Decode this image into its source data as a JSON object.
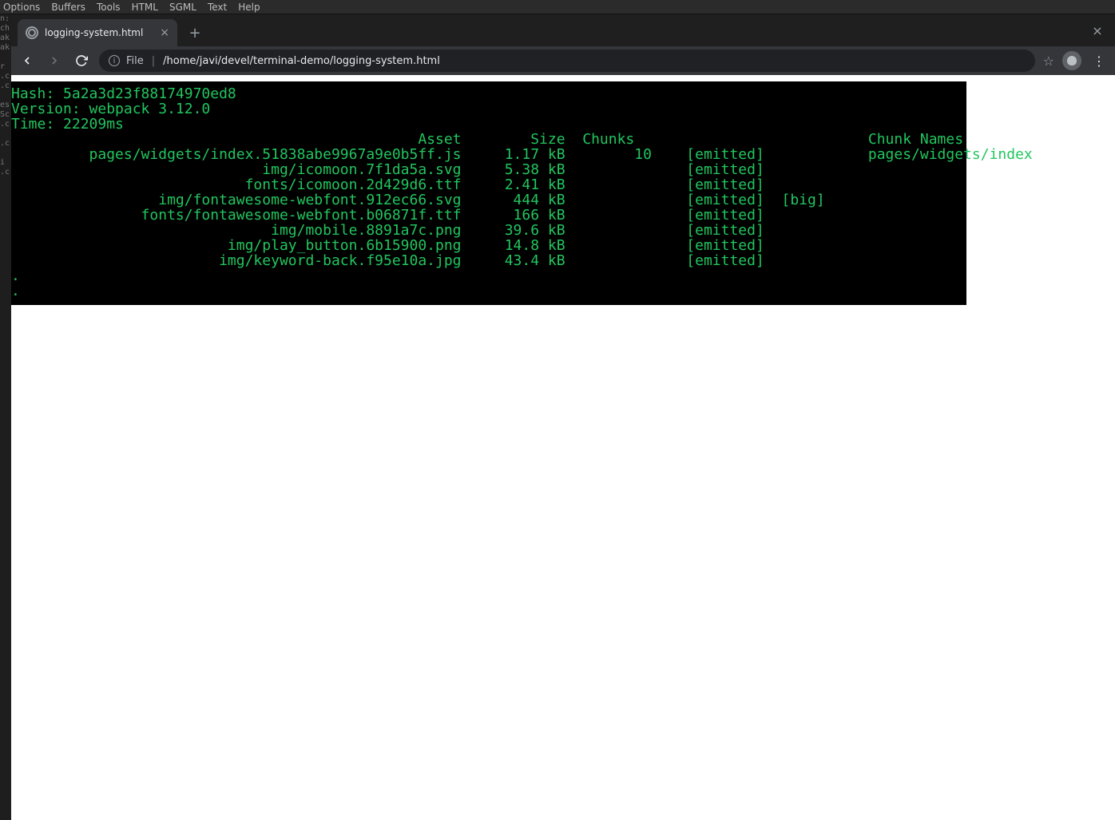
{
  "emacs_menu": [
    "Options",
    "Buffers",
    "Tools",
    "HTML",
    "SGML",
    "Text",
    "Help"
  ],
  "bg_editor_text": "n:\nch\nak\nak\n\nr\n.c\n.c\n\nes\nSc\n.c\n\n.c\n\ni\n.c",
  "browser": {
    "tab_title": "logging-system.html",
    "window_close": "×",
    "tab_close": "×",
    "newtab": "+",
    "nav": {
      "back": "←",
      "forward": "→",
      "reload": "⟳"
    },
    "omnibox": {
      "scheme": "File",
      "path": "/home/javi/devel/terminal-demo/logging-system.html"
    },
    "star": "☆",
    "kebab": "⋮"
  },
  "terminal": {
    "hash_label": "Hash:",
    "hash": "5a2a3d23f88174970ed8",
    "version_label": "Version:",
    "version": "webpack 3.12.0",
    "time_label": "Time:",
    "time": "22209ms",
    "columns": {
      "asset": "Asset",
      "size": "Size",
      "chunks": "Chunks",
      "chunk_names": "Chunk Names"
    },
    "rows": [
      {
        "asset": "pages/widgets/index.51838abe9967a9e0b5ff.js",
        "size": "1.17 kB",
        "chunks": "10",
        "flags": "[emitted]",
        "big": "",
        "chunk_names": "pages/widgets/index"
      },
      {
        "asset": "img/icomoon.7f1da5a.svg",
        "size": "5.38 kB",
        "chunks": "",
        "flags": "[emitted]",
        "big": "",
        "chunk_names": ""
      },
      {
        "asset": "fonts/icomoon.2d429d6.ttf",
        "size": "2.41 kB",
        "chunks": "",
        "flags": "[emitted]",
        "big": "",
        "chunk_names": ""
      },
      {
        "asset": "img/fontawesome-webfont.912ec66.svg",
        "size": "444 kB",
        "chunks": "",
        "flags": "[emitted]",
        "big": "[big]",
        "chunk_names": ""
      },
      {
        "asset": "fonts/fontawesome-webfont.b06871f.ttf",
        "size": "166 kB",
        "chunks": "",
        "flags": "[emitted]",
        "big": "",
        "chunk_names": ""
      },
      {
        "asset": "img/mobile.8891a7c.png",
        "size": "39.6 kB",
        "chunks": "",
        "flags": "[emitted]",
        "big": "",
        "chunk_names": ""
      },
      {
        "asset": "img/play_button.6b15900.png",
        "size": "14.8 kB",
        "chunks": "",
        "flags": "[emitted]",
        "big": "",
        "chunk_names": ""
      },
      {
        "asset": "img/keyword-back.f95e10a.jpg",
        "size": "43.4 kB",
        "chunks": "",
        "flags": "[emitted]",
        "big": "",
        "chunk_names": ""
      }
    ],
    "trailing_dots": [
      ".",
      "."
    ],
    "col_widths": {
      "asset": 49,
      "size": 10,
      "chunks": 8,
      "flags": 11,
      "big": 8,
      "chunk_names": 22
    }
  }
}
